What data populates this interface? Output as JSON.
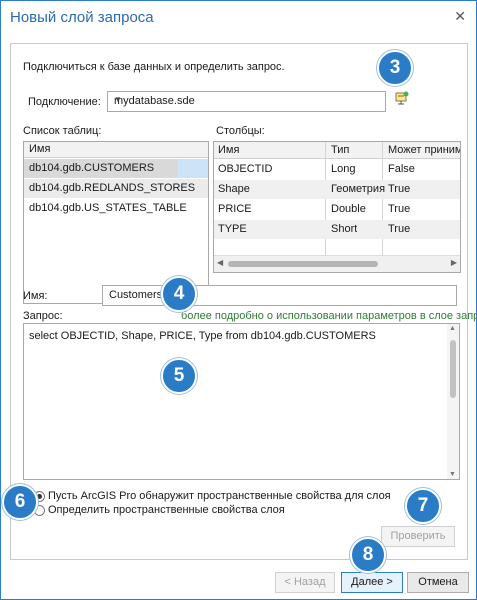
{
  "window": {
    "title": "Новый слой запроса",
    "close_glyph": "✕"
  },
  "connect_text": "Подключиться к базе данных и определить запрос.",
  "connection": {
    "label": "Подключение:",
    "value": "mydatabase.sde",
    "icon": "database-connection-icon"
  },
  "tables": {
    "label": "Список таблиц:",
    "header": "Имя",
    "items": [
      "db104.gdb.CUSTOMERS",
      "db104.gdb.REDLANDS_STORES",
      "db104.gdb.US_STATES_TABLE"
    ]
  },
  "columns": {
    "label": "Столбцы:",
    "headers": [
      "Имя",
      "Тип",
      "Может приним"
    ],
    "rows": [
      [
        "OBJECTID",
        "Long",
        "False"
      ],
      [
        "Shape",
        "Геометрия",
        "True"
      ],
      [
        "PRICE",
        "Double",
        "True"
      ],
      [
        "TYPE",
        "Short",
        "True"
      ]
    ]
  },
  "name": {
    "label": "Имя:",
    "value": "Customers"
  },
  "query": {
    "label": "Запрос:",
    "link": "более подробно о использовании параметров в слое запроса",
    "text": "select OBJECTID, Shape, PRICE, Type from db104.gdb.CUSTOMERS"
  },
  "spatial": {
    "option1": "Пусть ArcGIS Pro обнаружит пространственные свойства для слоя",
    "option2": "Определить пространственные свойства слоя",
    "selected": 1
  },
  "buttons": {
    "validate": "Проверить",
    "back": "< Назад",
    "next": "Далее >",
    "cancel": "Отмена"
  },
  "badges": [
    "3",
    "4",
    "5",
    "6",
    "7",
    "8"
  ],
  "colors": {
    "accent": "#2b7cc9",
    "badge": "#2a7cc7",
    "link": "#2e7d32",
    "selection": "#cce4f7"
  }
}
